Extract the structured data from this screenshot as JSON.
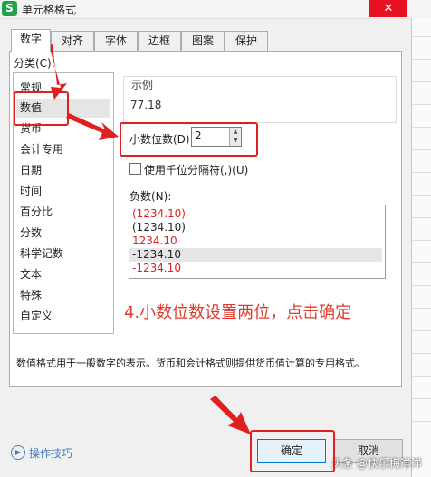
{
  "window": {
    "title": "单元格格式",
    "app_icon": "S",
    "close_glyph": "✕"
  },
  "tabs": [
    "数字",
    "对齐",
    "字体",
    "边框",
    "图案",
    "保护"
  ],
  "category": {
    "label": "分类(C):",
    "items": [
      "常规",
      "数值",
      "货币",
      "会计专用",
      "日期",
      "时间",
      "百分比",
      "分数",
      "科学记数",
      "文本",
      "特殊",
      "自定义"
    ],
    "selected": "数值"
  },
  "sample": {
    "title": "示例",
    "value": "77.18"
  },
  "decimal": {
    "label": "小数位数(D):",
    "value": "2"
  },
  "separator": {
    "label": "使用千位分隔符(,)(U)",
    "checked": false
  },
  "negative": {
    "label": "负数(N):",
    "items": [
      {
        "text": "(1234.10)",
        "color": "#e02020"
      },
      {
        "text": "(1234.10)",
        "color": "#222222"
      },
      {
        "text": "1234.10",
        "color": "#e02020"
      },
      {
        "text": "-1234.10",
        "color": "#222222"
      },
      {
        "text": "-1234.10",
        "color": "#e02020"
      }
    ],
    "selected_index": 3
  },
  "annotation": "4.小数位数设置两位，点击确定",
  "description": "数值格式用于一般数字的表示。货币和会计格式则提供货币值计算的专用格式。",
  "footer": {
    "tips": "操作技巧",
    "ok": "确定",
    "cancel": "取消"
  },
  "watermark": "头条 @快乐梅洋洋",
  "colors": {
    "highlight": "#e02020",
    "annotation": "#e23a2a",
    "accent": "#0078d7"
  }
}
